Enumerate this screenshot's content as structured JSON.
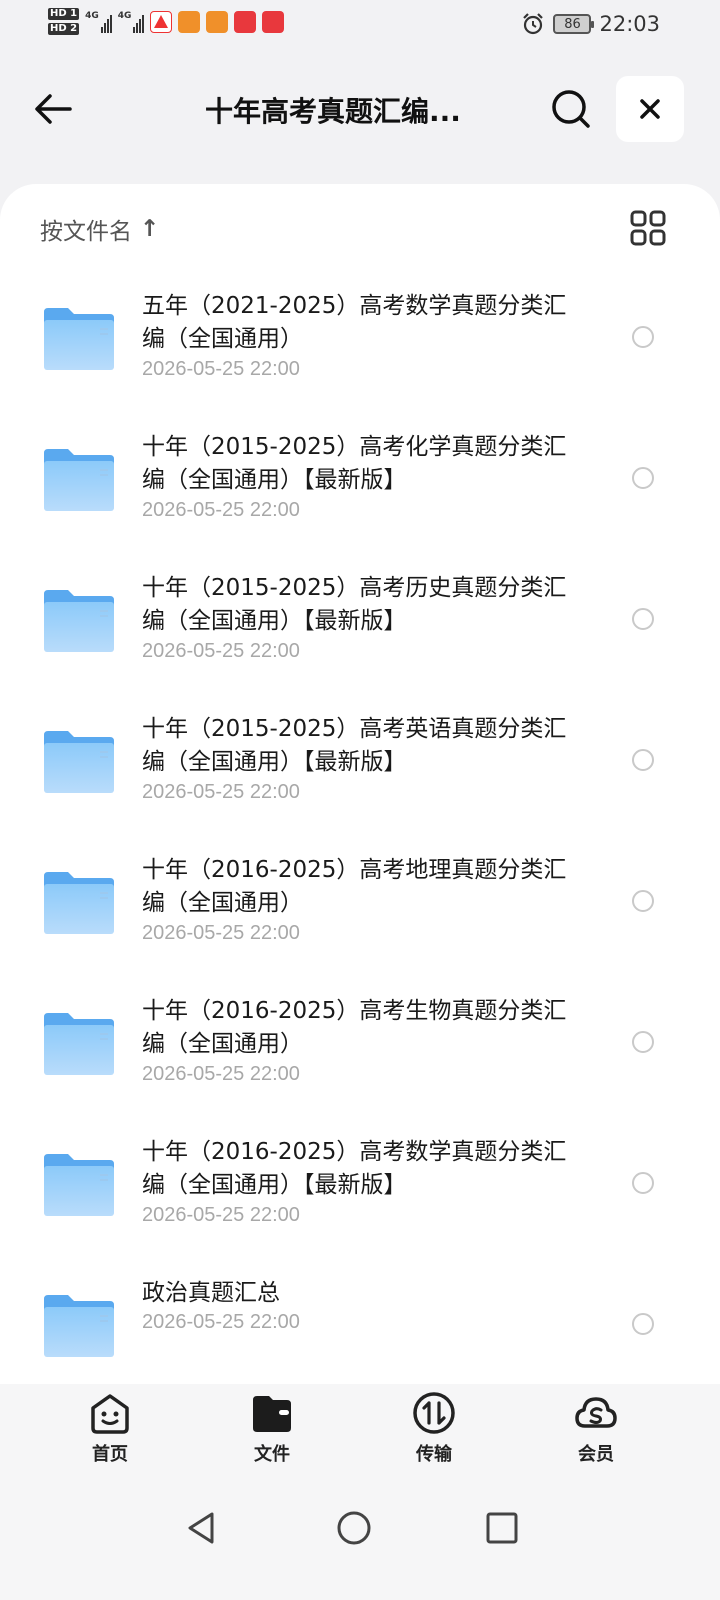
{
  "status_bar": {
    "hd1": "HD 1",
    "hd2": "HD 2",
    "net1": "4G",
    "net2": "4G",
    "battery": "86",
    "time": "22:03"
  },
  "header": {
    "title": "十年高考真题汇编..."
  },
  "sort": {
    "label": "按文件名",
    "arrow": "↑"
  },
  "files": [
    {
      "name": "五年（2021-2025）高考数学真题分类汇编（全国通用）",
      "date": "2026-05-25 22:00"
    },
    {
      "name": "十年（2015-2025）高考化学真题分类汇编（全国通用）【最新版】",
      "date": "2026-05-25 22:00"
    },
    {
      "name": "十年（2015-2025）高考历史真题分类汇编（全国通用）【最新版】",
      "date": "2026-05-25 22:00"
    },
    {
      "name": "十年（2015-2025）高考英语真题分类汇编（全国通用）【最新版】",
      "date": "2026-05-25 22:00"
    },
    {
      "name": "十年（2016-2025）高考地理真题分类汇编（全国通用）",
      "date": "2026-05-25 22:00"
    },
    {
      "name": "十年（2016-2025）高考生物真题分类汇编（全国通用）",
      "date": "2026-05-25 22:00"
    },
    {
      "name": "十年（2016-2025）高考数学真题分类汇编（全国通用）【最新版】",
      "date": "2026-05-25 22:00"
    },
    {
      "name": "政治真题汇总",
      "date": "2026-05-25 22:00"
    }
  ],
  "bottom_nav": [
    {
      "label": "首页",
      "icon": "home-face-icon"
    },
    {
      "label": "文件",
      "icon": "folder-wallet-icon"
    },
    {
      "label": "传输",
      "icon": "transfer-icon"
    },
    {
      "label": "会员",
      "icon": "vip-cloud-icon"
    }
  ],
  "colors": {
    "accent": "#1765f5",
    "folder": "#6fb6f5",
    "date_gray": "#a8a8a8"
  }
}
